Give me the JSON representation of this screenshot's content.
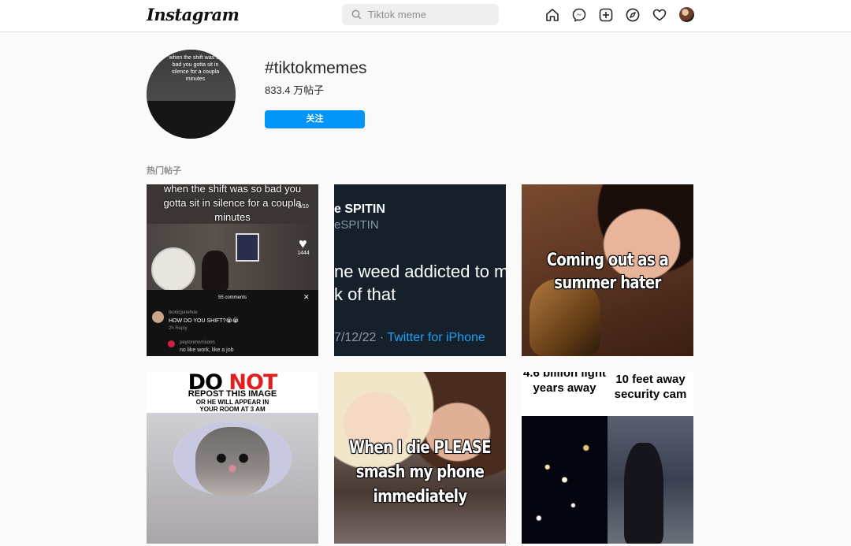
{
  "header": {
    "logo": "Instagram",
    "search_placeholder": "Tiktok meme",
    "icons": [
      "home-icon",
      "messenger-icon",
      "new-post-icon",
      "explore-icon",
      "activity-heart-icon",
      "profile-avatar"
    ]
  },
  "hashtag": {
    "title": "#tiktokmemes",
    "post_count": "833.4 万帖子",
    "follow_label": "关注"
  },
  "section": {
    "top_posts_label": "热门帖子"
  },
  "posts": {
    "p1": {
      "caption": "when the shift was so bad you gotta sit in silence for a coupla minutes",
      "side_count": "3/10",
      "like_count": "1444",
      "comments_header": "55 comments",
      "close": "✕",
      "c1_user": "ikonicjunehoe",
      "c1_text": "HOW DO YOU SHIFT?😭😭",
      "c1_meta": "2h  Reply",
      "c2_user": "peytonmorrisonn",
      "c2_text": "no like work, like a job"
    },
    "p2": {
      "name": "e SPITIN",
      "handle": "eSPITIN",
      "body_line1": "ne weed addicted to m",
      "body_line2": "k of that",
      "date": "7/12/22 · ",
      "source": "Twitter for iPhone"
    },
    "p3": {
      "text": "Coming out as a summer hater"
    },
    "p4": {
      "do": "DO ",
      "not": "NOT",
      "line1": "REPOST THIS IMAGE",
      "line2": "OR HE WILL APPEAR IN",
      "line3": "YOUR ROOM AT 3 AM"
    },
    "p5": {
      "text": "When I die PLEASE smash my phone immediately"
    },
    "p6": {
      "left_text": "4.6 billion light years away",
      "right_text": "10 feet away security cam"
    }
  },
  "colors": {
    "accent": "#0095f6",
    "twitter_blue": "#1da1f2"
  }
}
